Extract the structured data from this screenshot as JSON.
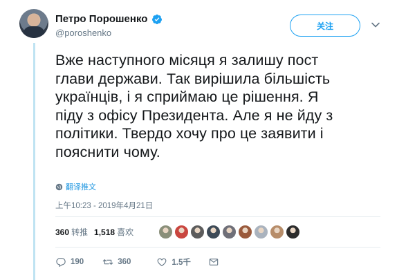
{
  "author": {
    "display_name": "Петро Порошенко",
    "handle": "@poroshenko",
    "verified": true
  },
  "follow_button": {
    "label": "关注"
  },
  "tweet": {
    "text": "Вже наступного місяця я залишу пост\nглави держави. Так вирішила більшість\nукраїнців, і я сприймаю це рішення. Я\nпіду з офісу Президента. Але я не йду з\nполітики. Твердо хочу про це заявити і\nпояснити чому.",
    "translate_label": "翻译推文",
    "timestamp": "上午10:23 - 2019年4月21日"
  },
  "stats": {
    "retweets_count": "360",
    "retweets_label": "转推",
    "likes_count": "1,518",
    "likes_label": "喜欢"
  },
  "likers": [
    {
      "color": "#8a8f7a"
    },
    {
      "color": "#c9463f"
    },
    {
      "color": "#5c5c5c"
    },
    {
      "color": "#3d4a57"
    },
    {
      "color": "#6f6f78"
    },
    {
      "color": "#9a5a3c"
    },
    {
      "color": "#aab3be"
    },
    {
      "color": "#b78d6a"
    },
    {
      "color": "#2c2c2c"
    }
  ],
  "actions": {
    "reply_count": "190",
    "retweet_count": "360",
    "like_count": "1.5千"
  },
  "colors": {
    "accent": "#1da1f2",
    "thread_line": "#bfe3f2",
    "secondary_text": "#657786"
  }
}
